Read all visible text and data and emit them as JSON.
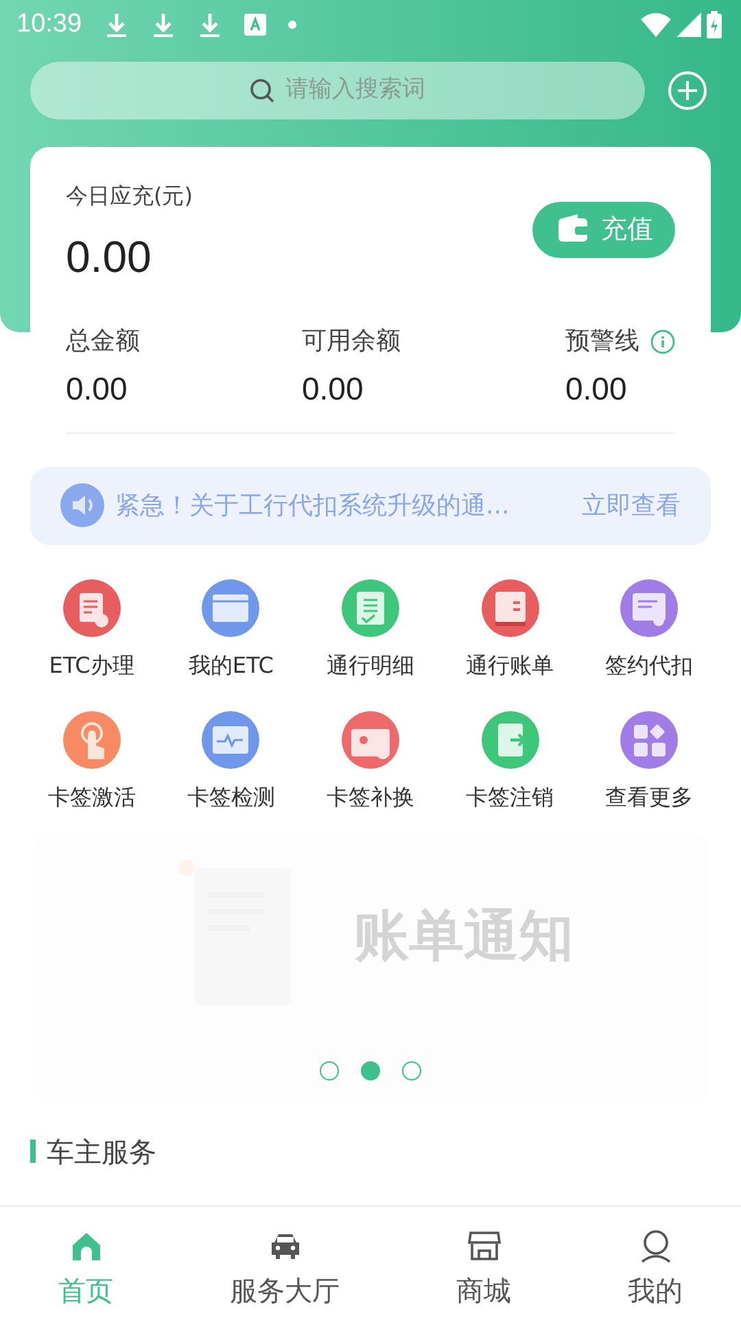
{
  "status_bar": {
    "time": "10:39"
  },
  "search": {
    "placeholder": "请输入搜索词"
  },
  "recharge_card": {
    "label": "今日应充(元)",
    "amount": "0.00",
    "button": "充值"
  },
  "stats": [
    {
      "label": "总金额",
      "value": "0.00",
      "info": false
    },
    {
      "label": "可用余额",
      "value": "0.00",
      "info": false
    },
    {
      "label": "预警线",
      "value": "0.00",
      "info": true
    }
  ],
  "notice": {
    "text": "紧急！关于工行代扣系统升级的通...",
    "link": "立即查看"
  },
  "services": [
    {
      "label": "ETC办理",
      "kind": "form",
      "color": "#e85d5d"
    },
    {
      "label": "我的ETC",
      "kind": "card",
      "color": "#6f97ea"
    },
    {
      "label": "通行明细",
      "kind": "clipboard",
      "color": "#3ec67a"
    },
    {
      "label": "通行账单",
      "kind": "bill",
      "color": "#e85d5d"
    },
    {
      "label": "签约代扣",
      "kind": "sign",
      "color": "#a07de6"
    },
    {
      "label": "卡签激活",
      "kind": "touch",
      "color": "#f78a62"
    },
    {
      "label": "卡签检测",
      "kind": "pulse",
      "color": "#6f97ea"
    },
    {
      "label": "卡签补换",
      "kind": "swap",
      "color": "#ee6a6a"
    },
    {
      "label": "卡签注销",
      "kind": "exit",
      "color": "#3ec67a"
    },
    {
      "label": "查看更多",
      "kind": "more",
      "color": "#a07de6"
    }
  ],
  "banner": {
    "title": "账单通知",
    "dots": [
      {
        "selected": false
      },
      {
        "selected": true
      },
      {
        "selected": false
      }
    ]
  },
  "section_title": "车主服务",
  "tabs": [
    {
      "label": "首页",
      "kind": "home",
      "selected": true
    },
    {
      "label": "服务大厅",
      "kind": "car",
      "selected": false
    },
    {
      "label": "商城",
      "kind": "shop",
      "selected": false
    },
    {
      "label": "我的",
      "kind": "user",
      "selected": false
    }
  ]
}
